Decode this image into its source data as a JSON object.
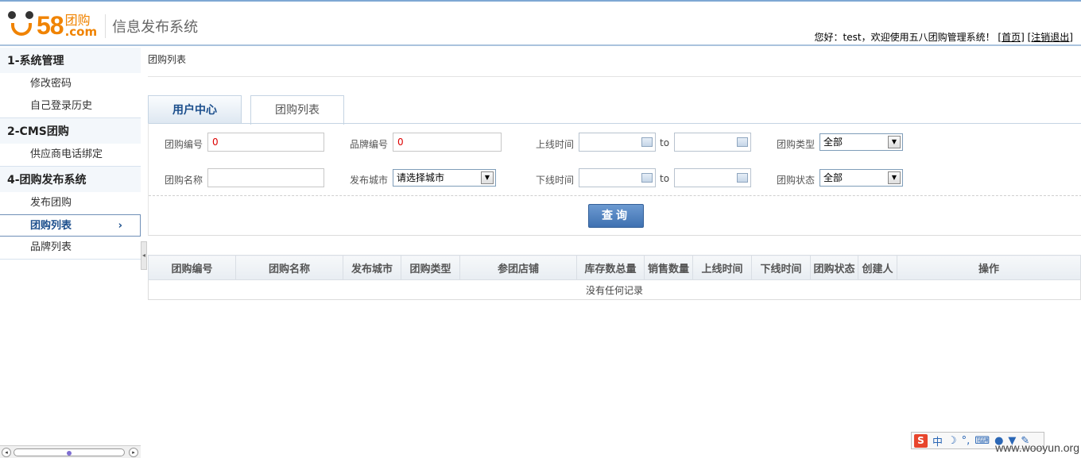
{
  "header": {
    "logo_number": "58",
    "logo_tuangou": "团购",
    "logo_com": ".com",
    "system_title": "信息发布系统",
    "welcome_text": "您好：test，欢迎使用五八团购管理系统！",
    "home_link": "[首页]",
    "logout_link": "[注销退出]"
  },
  "sidebar": {
    "groups": [
      {
        "title": "1-系统管理",
        "items": [
          "修改密码",
          "自己登录历史"
        ]
      },
      {
        "title": "2-CMS团购",
        "items": [
          "供应商电话绑定"
        ]
      },
      {
        "title": "4-团购发布系统",
        "items": [
          "发布团购",
          "团购列表",
          "品牌列表"
        ]
      }
    ],
    "active_item": "团购列表"
  },
  "breadcrumb": "团购列表",
  "tabs": [
    "用户中心",
    "团购列表"
  ],
  "filters": {
    "group_id_label": "团购编号",
    "group_id_value": "0",
    "brand_id_label": "品牌编号",
    "brand_id_value": "0",
    "online_time_label": "上线时间",
    "to_label": "to",
    "group_type_label": "团购类型",
    "group_type_value": "全部",
    "group_name_label": "团购名称",
    "group_name_value": "",
    "city_label": "发布城市",
    "city_value": "请选择城市",
    "offline_time_label": "下线时间",
    "group_status_label": "团购状态",
    "group_status_value": "全部",
    "query_button": "查询"
  },
  "table": {
    "headers": [
      "团购编号",
      "团购名称",
      "发布城市",
      "团购类型",
      "参团店铺",
      "库存数总量",
      "销售数量",
      "上线时间",
      "下线时间",
      "团购状态",
      "创建人",
      "操作"
    ],
    "empty_message": "没有任何记录"
  },
  "ime": {
    "zhong": "中",
    "moon": "☽",
    "dot": "°,"
  },
  "watermark": "www.wooyun.org",
  "colors": {
    "accent_orange": "#f08300",
    "link_blue": "#1b4e8c",
    "button_blue": "#3f71b1"
  }
}
